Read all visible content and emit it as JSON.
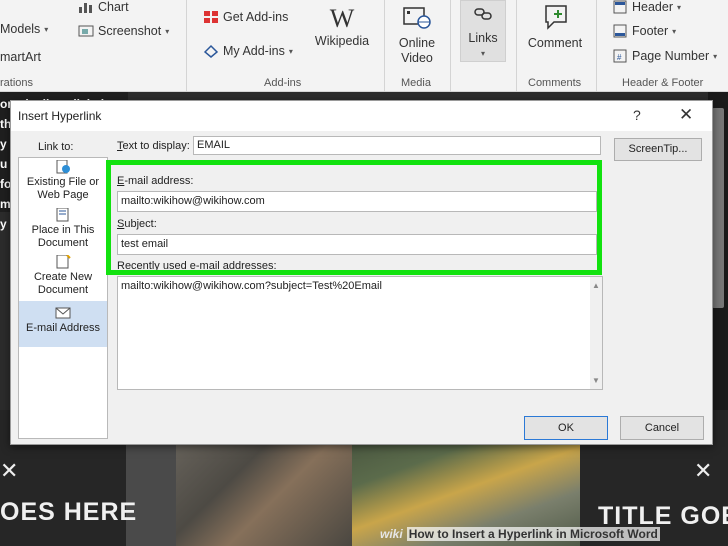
{
  "ribbon": {
    "models": "Models",
    "chart": "Chart",
    "screenshot": "Screenshot",
    "smartart": "martArt",
    "illustrations_group": "rations",
    "get_addins": "Get Add-ins",
    "my_addins": "My Add-ins",
    "wikipedia": "Wikipedia",
    "addins_group": "Add-ins",
    "online_video": "Online\nVideo",
    "media_group": "Media",
    "links": "Links",
    "comment": "Comment",
    "comments_group": "Comments",
    "header": "Header",
    "footer": "Footer",
    "page_number": "Page Number",
    "header_footer_group": "Header & Footer"
  },
  "background": {
    "side_text_lines": [
      "om the list, click the",
      "th",
      "y",
      "u",
      "fo",
      "m",
      "y"
    ],
    "left_title": "OES HERE",
    "right_title": "TITLE GOE"
  },
  "dialog": {
    "title": "Insert Hyperlink",
    "help": "?",
    "close": "✕",
    "link_to_label": "Link to:",
    "link_items": [
      {
        "label": "Existing File or Web Page",
        "icon": "file-globe-icon",
        "selected": false
      },
      {
        "label": "Place in This Document",
        "icon": "document-bookmark-icon",
        "selected": false
      },
      {
        "label": "Create New Document",
        "icon": "new-document-icon",
        "selected": false
      },
      {
        "label": "E-mail Address",
        "icon": "email-icon",
        "selected": true
      }
    ],
    "text_to_display_label": "Text to display:",
    "text_to_display_value": "EMAIL",
    "screentip_button": "ScreenTip...",
    "email_label": "E-mail address:",
    "email_value": "mailto:wikihow@wikihow.com",
    "subject_label": "Subject:",
    "subject_value": "test email",
    "recent_label": "Recently used e-mail addresses:",
    "recent_items": [
      "mailto:wikihow@wikihow.com?subject=Test%20Email"
    ],
    "ok_button": "OK",
    "cancel_button": "Cancel",
    "highlight_color": "#12e20f"
  },
  "watermark": {
    "logo": "wiki",
    "text": "How to Insert a Hyperlink in Microsoft Word"
  }
}
